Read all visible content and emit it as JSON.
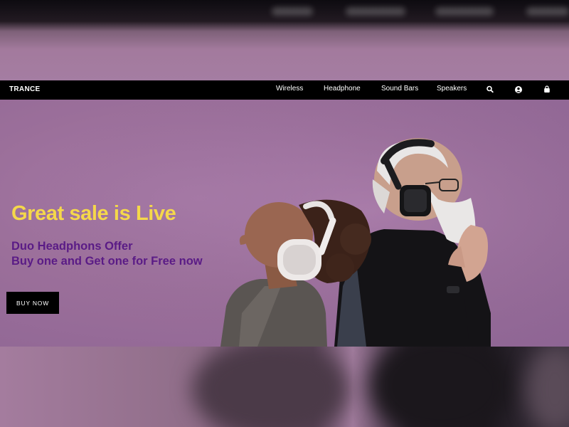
{
  "brand": {
    "logo": "TRANCE"
  },
  "nav": {
    "links": [
      "Wireless",
      "Headphone",
      "Sound Bars",
      "Speakers"
    ],
    "icons": [
      "search-icon",
      "user-icon",
      "cart-icon"
    ]
  },
  "hero": {
    "headline": "Great sale is Live",
    "subline_1": "Duo Headphons Offer",
    "subline_2": "Buy one and Get one for Free now",
    "cta": "BUY NOW"
  },
  "colors": {
    "headline": "#f5d84a",
    "subline": "#5a1b86",
    "navbar": "#000000",
    "hero_bg": "#9b6f9a"
  }
}
